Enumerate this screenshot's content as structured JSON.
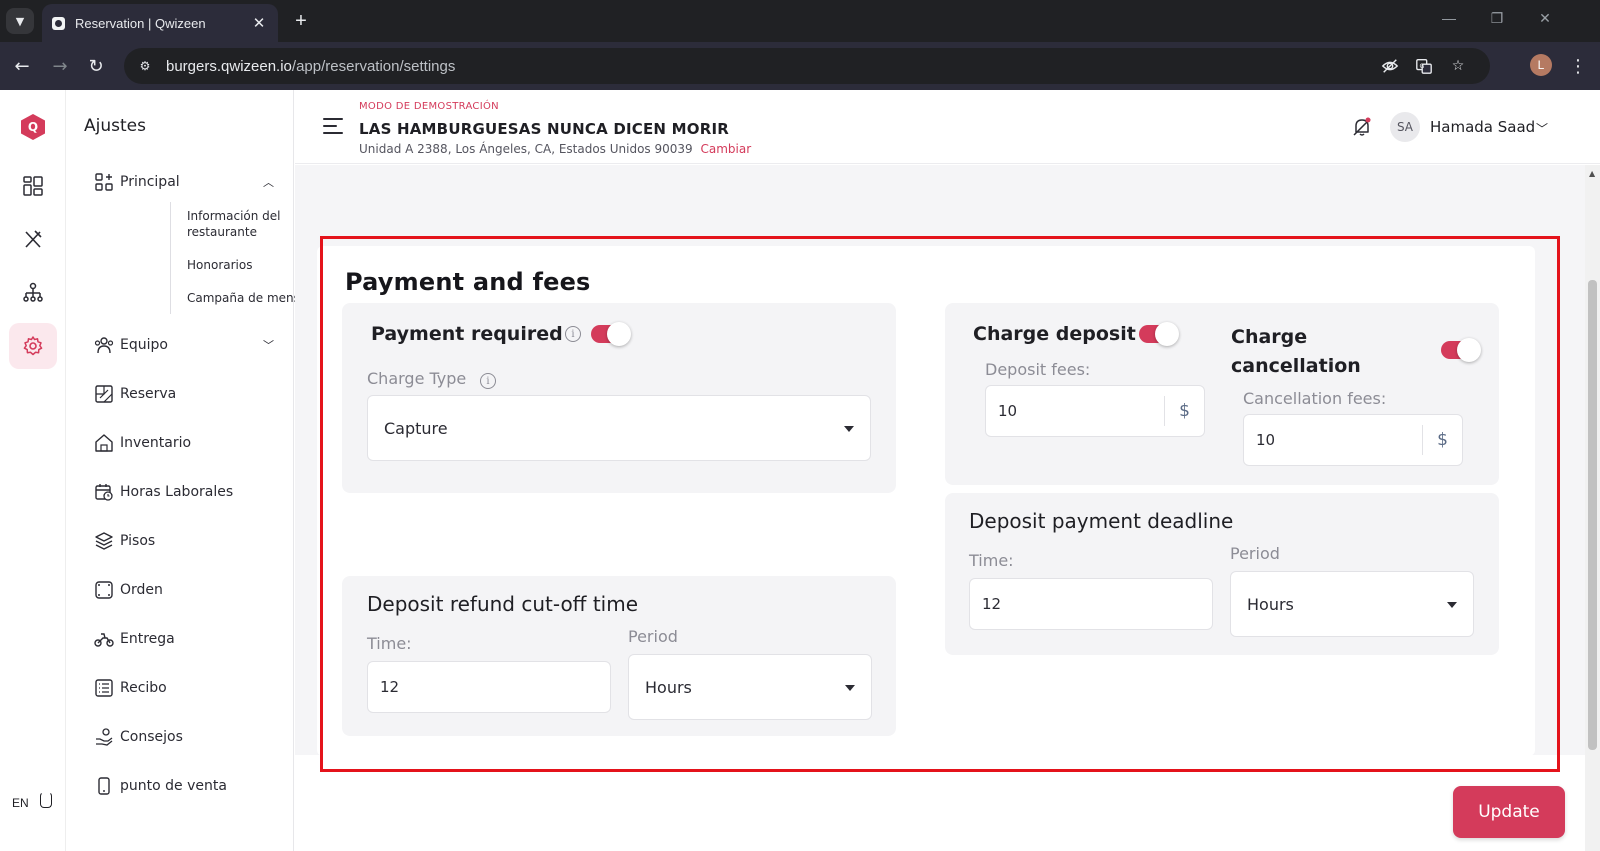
{
  "browser": {
    "tab_title": "Reservation | Qwizeen",
    "url_host": "burgers.qwizeen.io",
    "url_path": "/app/reservation/settings",
    "profile_initial": "L"
  },
  "app": {
    "logo_letter": "Q",
    "language": "EN",
    "brand_color": "#d43b5b"
  },
  "sidenav": {
    "title": "Ajustes",
    "principal": "Principal",
    "sub_items": [
      "Información del restaurante",
      "Honorarios",
      "Campaña de mensajes"
    ],
    "equipo": "Equipo",
    "reserva": "Reserva",
    "inventario": "Inventario",
    "horas": "Horas Laborales",
    "pisos": "Pisos",
    "orden": "Orden",
    "entrega": "Entrega",
    "recibo": "Recibo",
    "consejos": "Consejos",
    "pos": "punto de venta"
  },
  "header": {
    "demo_mode": "MODO DE DEMOSTRACIÓN",
    "store_name": "LAS HAMBURGUESAS NUNCA DICEN MORIR",
    "address": "Unidad A 2388, Los Ángeles, CA, Estados Unidos 90039",
    "change_link": "Cambiar",
    "user_initials": "SA",
    "user_name": "Hamada Saad"
  },
  "payment": {
    "section_title": "Payment and fees",
    "payment_required_label": "Payment required",
    "payment_required_on": true,
    "charge_type_label": "Charge Type",
    "charge_type_value": "Capture",
    "charge_deposit_label": "Charge deposit",
    "charge_deposit_on": true,
    "deposit_fees_label": "Deposit fees:",
    "deposit_fees_value": "10",
    "charge_cancellation_label": "Charge cancellation",
    "charge_cancellation_on": true,
    "cancellation_fees_label": "Cancellation fees:",
    "cancellation_fees_value": "10",
    "currency_symbol": "$",
    "deadline_title": "Deposit payment deadline",
    "deadline_time_label": "Time:",
    "deadline_time_value": "12",
    "deadline_period_label": "Period",
    "deadline_period_value": "Hours",
    "refund_title": "Deposit refund cut-off time",
    "refund_time_label": "Time:",
    "refund_time_value": "12",
    "refund_period_label": "Period",
    "refund_period_value": "Hours"
  },
  "actions": {
    "update_label": "Update"
  }
}
